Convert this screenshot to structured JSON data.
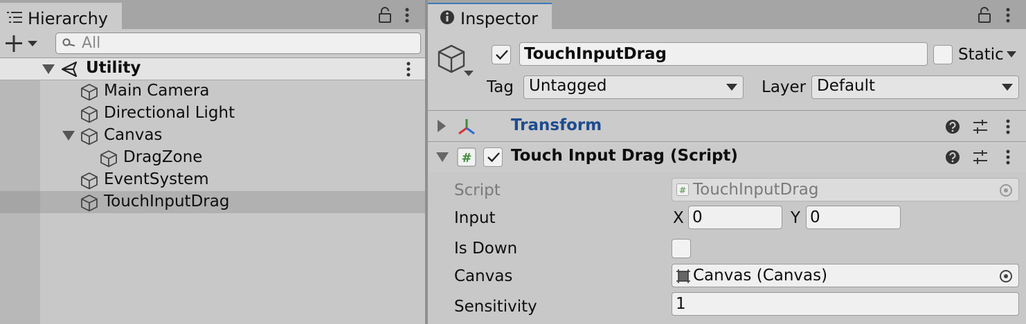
{
  "hierarchy": {
    "tab_label": "Hierarchy",
    "search_placeholder": "All",
    "scene_name": "Utility",
    "items": [
      {
        "label": "Main Camera"
      },
      {
        "label": "Directional Light"
      },
      {
        "label": "Canvas"
      },
      {
        "label": "DragZone"
      },
      {
        "label": "EventSystem"
      },
      {
        "label": "TouchInputDrag",
        "selected": true
      }
    ]
  },
  "inspector": {
    "tab_label": "Inspector",
    "object_name": "TouchInputDrag",
    "static_label": "Static",
    "tag_label": "Tag",
    "tag_value": "Untagged",
    "layer_label": "Layer",
    "layer_value": "Default",
    "components": {
      "transform": {
        "title": "Transform"
      },
      "script": {
        "title": "Touch Input Drag (Script)",
        "fields": {
          "script_label": "Script",
          "script_value": "TouchInputDrag",
          "input_label": "Input",
          "x_label": "X",
          "x_value": "0",
          "y_label": "Y",
          "y_value": "0",
          "isdown_label": "Is Down",
          "canvas_label": "Canvas",
          "canvas_value": "Canvas (Canvas)",
          "sensitivity_label": "Sensitivity",
          "sensitivity_value": "1"
        }
      }
    }
  },
  "colors": {
    "accent": "#3a79bb",
    "transform_title": "#1e4b8f",
    "script_hash": "#3f8a3a"
  }
}
